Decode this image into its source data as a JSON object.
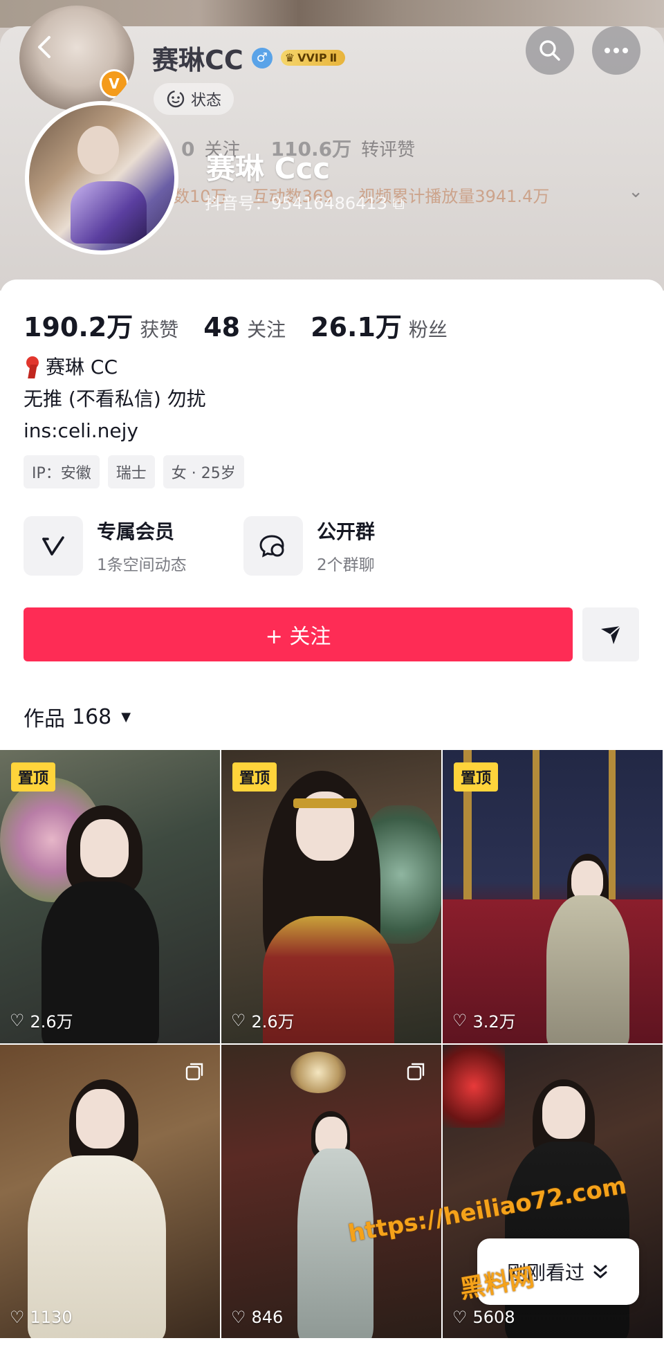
{
  "header": {
    "back_icon": "chevron-left-icon",
    "small_name": "赛琳CC",
    "vip_label": "VVIP",
    "vip_level": "Ⅱ",
    "status_label": "状态",
    "search_icon": "search-icon",
    "more_icon": "more-icon",
    "ghost_stats": {
      "following_num": "0",
      "following_label": "关注",
      "reposts_num": "110.6万",
      "reposts_label": "转评赞"
    },
    "ghost_row2": {
      "fans_text": "数10万",
      "interactions_text": "互动数369",
      "plays_text": "视频累计播放量3941.4万"
    },
    "nickname": "赛琳 Ccc",
    "douyin_id": "抖音号：95416486413"
  },
  "stats": [
    {
      "num": "190.2万",
      "label": "获赞"
    },
    {
      "num": "48",
      "label": "关注"
    },
    {
      "num": "26.1万",
      "label": "粉丝"
    }
  ],
  "bio": {
    "line1": "赛琳 CC",
    "line2": "无推 (不看私信) 勿扰",
    "line3": "ins:celi.nejy"
  },
  "tags": [
    "IP：安徽",
    "瑞士",
    "女 · 25岁"
  ],
  "cards": [
    {
      "title": "专属会员",
      "sub": "1条空间动态",
      "icon": "vip-v-icon"
    },
    {
      "title": "公开群",
      "sub": "2个群聊",
      "icon": "group-chat-icon"
    }
  ],
  "actions": {
    "follow_label": "+ 关注",
    "dm_icon": "send-icon"
  },
  "works": {
    "label": "作品",
    "count": "168"
  },
  "videos": [
    {
      "likes": "2.6万",
      "pinned": true,
      "pin_label": "置顶"
    },
    {
      "likes": "2.6万",
      "pinned": true,
      "pin_label": "置顶"
    },
    {
      "likes": "3.2万",
      "pinned": true,
      "pin_label": "置顶"
    },
    {
      "likes": "1130",
      "pinned": false,
      "multi": true
    },
    {
      "likes": "846",
      "pinned": false,
      "multi": true
    },
    {
      "likes": "5608",
      "pinned": false,
      "multi": false
    }
  ],
  "recent": {
    "label": "刚刚看过",
    "icon": "double-chevron-down-icon"
  },
  "watermark": {
    "url": "https://heiliao72.com",
    "name": "黑料网"
  }
}
